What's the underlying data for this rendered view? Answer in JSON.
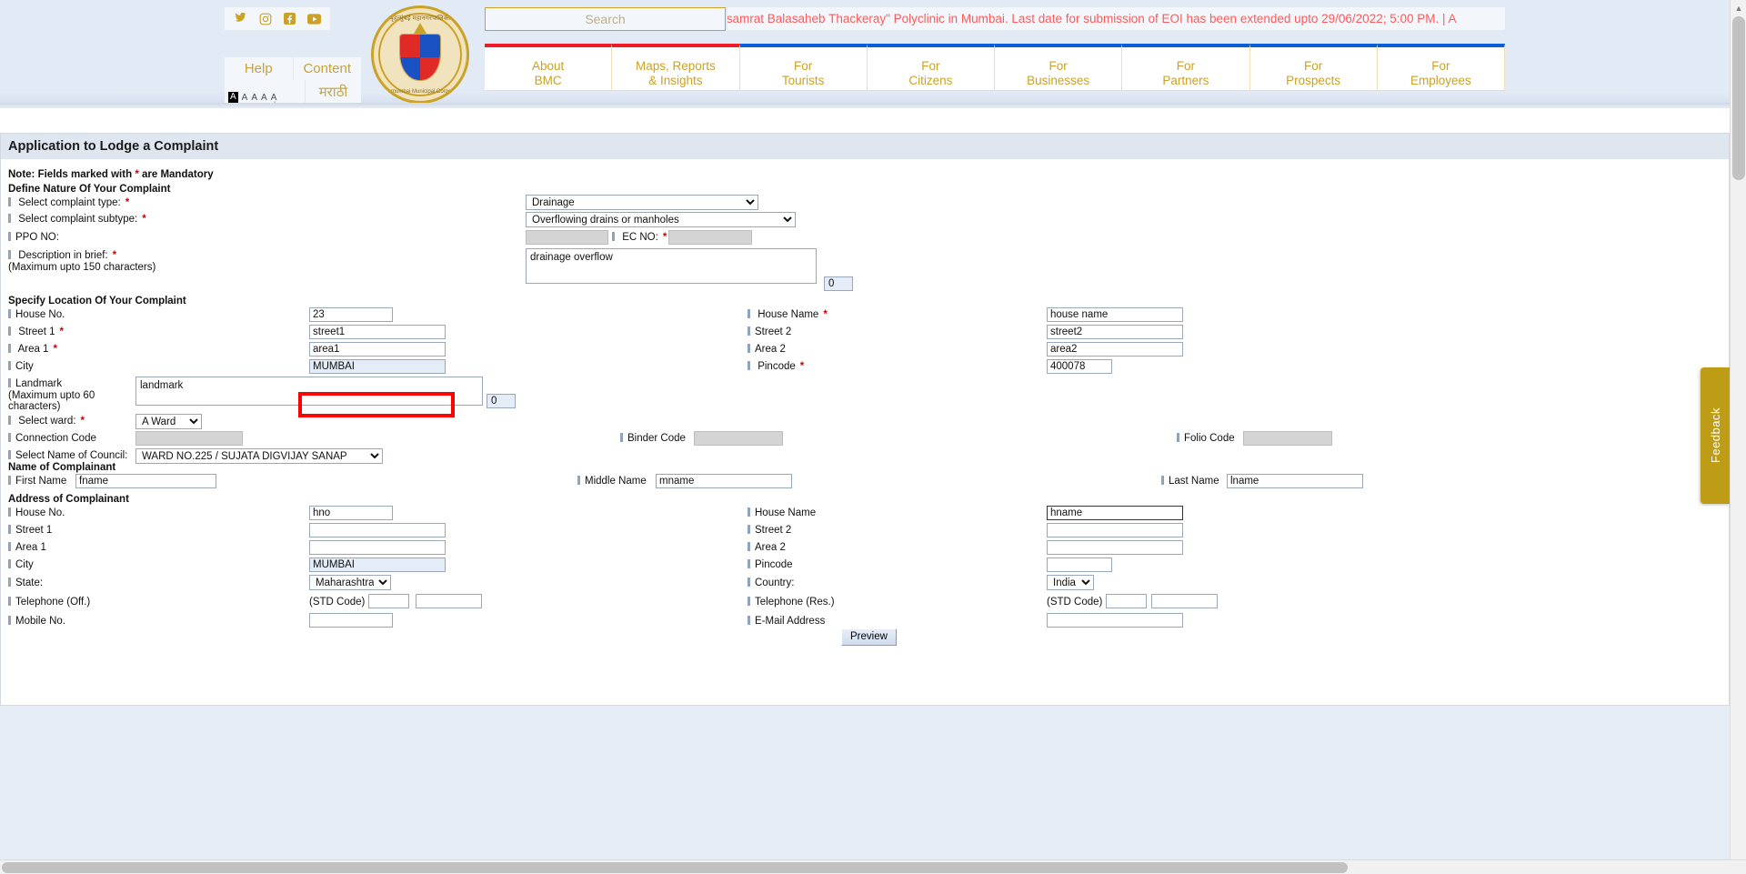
{
  "header": {
    "social": [
      "twitter-icon",
      "instagram-icon",
      "facebook-icon",
      "youtube-icon"
    ],
    "help_label": "Help",
    "content_label": "Content",
    "font_sizes": [
      "A",
      "A",
      "A",
      "A",
      "A"
    ],
    "marathi_label": "मराठी",
    "logo": {
      "top_text": "बृहन्मुंबई महानगरपालिका",
      "bottom_text": "Brihanmumbai Municipal Corporation"
    },
    "search": {
      "placeholder": "Search",
      "value": ""
    },
    "marquee": "ysamrat Balasaheb Thackeray\" Polyclinic in Mumbai. Last date for submission of EOI has been extended upto 29/06/2022; 5:00 PM. | A",
    "nav": [
      {
        "line1": "About",
        "line2": "BMC",
        "accent": "#ee1c25"
      },
      {
        "line1": "Maps, Reports",
        "line2": "& Insights",
        "accent": "#ee1c25"
      },
      {
        "line1": "For",
        "line2": "Tourists",
        "accent": "#0b5ed7"
      },
      {
        "line1": "For",
        "line2": "Citizens",
        "accent": "#0b5ed7"
      },
      {
        "line1": "For",
        "line2": "Businesses",
        "accent": "#0b5ed7"
      },
      {
        "line1": "For",
        "line2": "Partners",
        "accent": "#0b5ed7"
      },
      {
        "line1": "For",
        "line2": "Prospects",
        "accent": "#0b5ed7"
      },
      {
        "line1": "For",
        "line2": "Employees",
        "accent": "#0b5ed7"
      }
    ]
  },
  "form": {
    "title": "Application to Lodge a Complaint",
    "note_prefix": "Note: Fields marked with ",
    "note_star": "*",
    "note_suffix": " are Mandatory",
    "section_nature": "Define Nature Of Your Complaint",
    "section_location": "Specify Location Of Your Complaint",
    "section_name": "Name of Complainant",
    "section_address": "Address of Complainant",
    "complaint_type": {
      "label": "Select complaint type:",
      "value": "Drainage"
    },
    "complaint_subtype": {
      "label": "Select complaint subtype:",
      "value": "Overflowing drains or manholes"
    },
    "ppo_no": {
      "label": "PPO NO:",
      "value": ""
    },
    "ec_no": {
      "label": "EC NO:",
      "value": ""
    },
    "description": {
      "label": "Description in brief:",
      "hint": "(Maximum upto 150 characters)",
      "value": "drainage overflow",
      "counter": "0"
    },
    "loc_house_no": {
      "label": "House No.",
      "value": "23"
    },
    "loc_street1": {
      "label": "Street 1",
      "value": "street1"
    },
    "loc_area1": {
      "label": "Area 1",
      "value": "area1"
    },
    "loc_city": {
      "label": "City",
      "value": "MUMBAI"
    },
    "loc_house_name": {
      "label": "House Name",
      "value": "house name"
    },
    "loc_street2": {
      "label": "Street 2",
      "value": "street2"
    },
    "loc_area2": {
      "label": "Area 2",
      "value": "area2"
    },
    "loc_pincode": {
      "label": "Pincode",
      "value": "400078"
    },
    "landmark": {
      "label": "Landmark",
      "hint1": "(Maximum upto 60",
      "hint2": "characters)",
      "value": "landmark",
      "counter": "0"
    },
    "ward": {
      "label": "Select ward:",
      "value": "A Ward"
    },
    "connection_code": {
      "label": "Connection Code",
      "value": ""
    },
    "binder_code": {
      "label": "Binder Code",
      "value": ""
    },
    "folio_code": {
      "label": "Folio Code",
      "value": ""
    },
    "council": {
      "label": "Select Name of Council:",
      "value": "WARD NO.225 / SUJATA DIGVIJAY SANAP"
    },
    "first_name": {
      "label": "First Name",
      "value": "fname"
    },
    "middle_name": {
      "label": "Middle Name",
      "value": "mname"
    },
    "last_name": {
      "label": "Last Name",
      "value": "lname"
    },
    "addr_house_no": {
      "label": "House No.",
      "value": "hno"
    },
    "addr_street1": {
      "label": "Street 1",
      "value": ""
    },
    "addr_area1": {
      "label": "Area 1",
      "value": ""
    },
    "addr_city": {
      "label": "City",
      "value": "MUMBAI"
    },
    "addr_state": {
      "label": "State:",
      "value": "Maharashtra"
    },
    "addr_house_name": {
      "label": "House Name",
      "value": "hname"
    },
    "addr_street2": {
      "label": "Street 2",
      "value": ""
    },
    "addr_area2": {
      "label": "Area 2",
      "value": ""
    },
    "addr_pincode": {
      "label": "Pincode",
      "value": ""
    },
    "addr_country": {
      "label": "Country:",
      "value": "India"
    },
    "tel_off": {
      "label": "Telephone (Off.)",
      "std_label": "(STD Code)",
      "std": "",
      "value": ""
    },
    "tel_res": {
      "label": "Telephone (Res.)",
      "std_label": "(STD Code)",
      "std": "",
      "value": ""
    },
    "mobile": {
      "label": "Mobile No.",
      "value": ""
    },
    "email": {
      "label": "E-Mail Address",
      "value": ""
    },
    "preview_button": "Preview"
  },
  "feedback_tab": "Feedback"
}
